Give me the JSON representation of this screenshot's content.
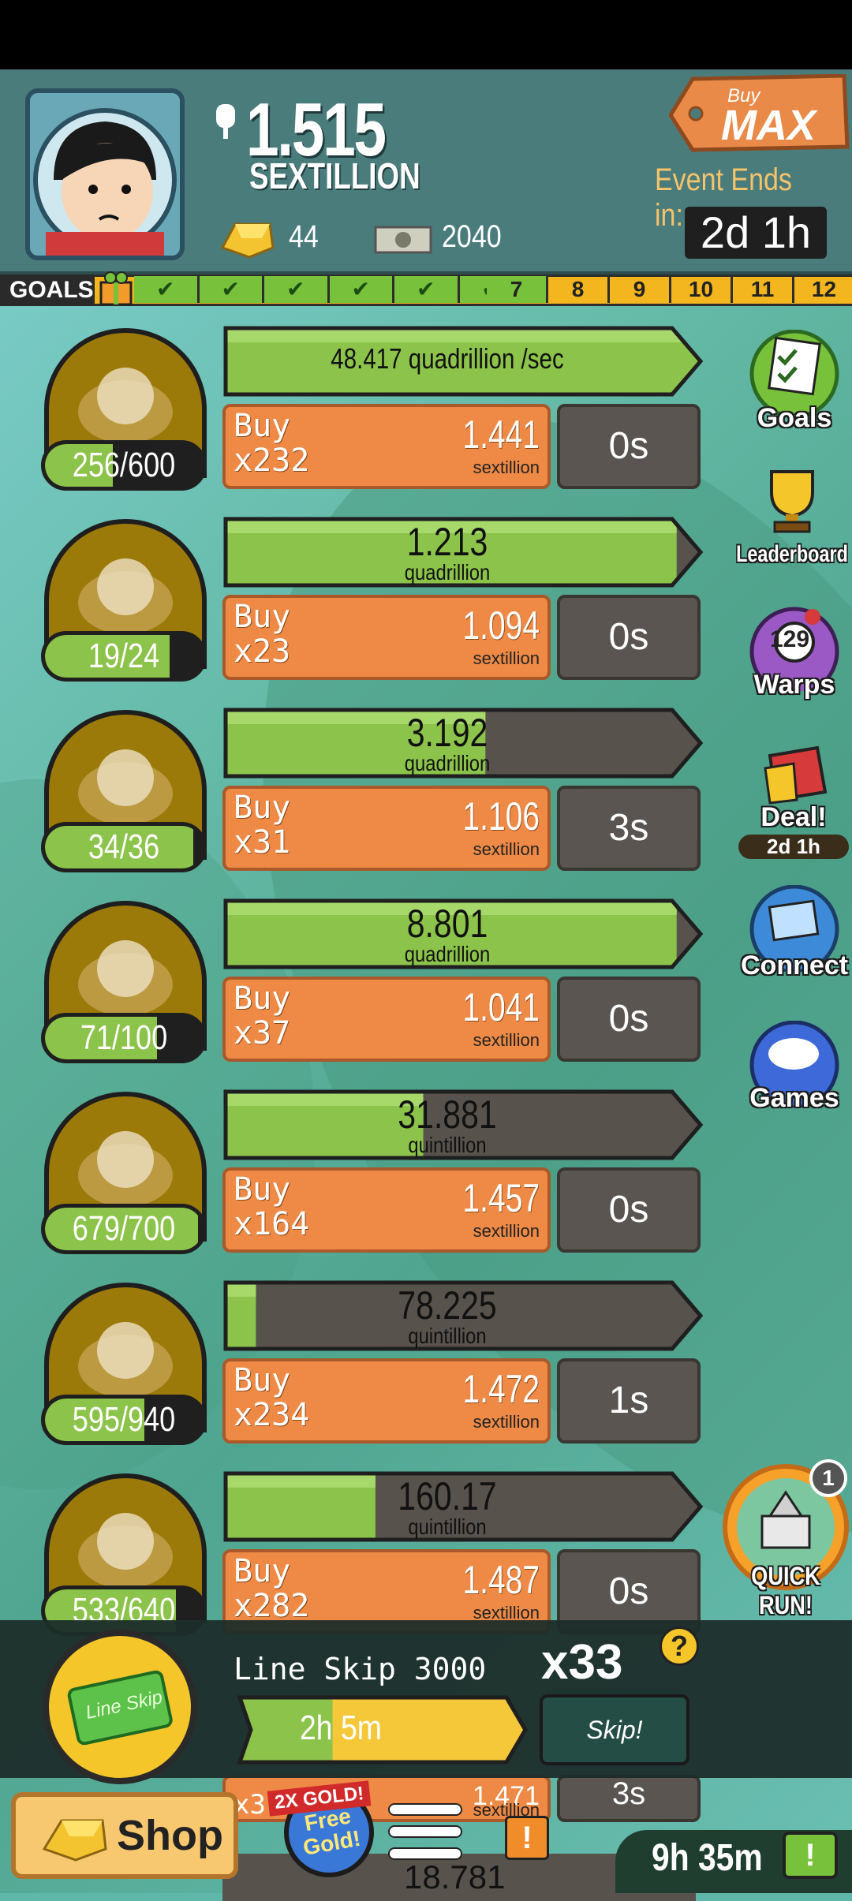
{
  "header": {
    "money_value": "1.515",
    "money_unit": "SEXTILLION",
    "gold_count": "44",
    "megabucks_count": "2040",
    "buy_max_prefix": "Buy",
    "buy_max_label": "MAX",
    "event_label": "Event Ends in:",
    "event_timer": "2d 1h"
  },
  "goals_bar": {
    "label": "GOALS",
    "completed_count": 6,
    "upcoming": [
      "7",
      "8",
      "9",
      "10",
      "11",
      "12"
    ]
  },
  "businesses": [
    {
      "icon": "lemonade-road-icon",
      "count": "256/600",
      "count_progress": 0.43,
      "production": "48.417 quadrillion /sec",
      "production_unit": "",
      "production_progress": 1.0,
      "buy_label": "Buy",
      "buy_qty": "x232",
      "cost": "1.441",
      "cost_unit": "sextillion",
      "timer": "0s"
    },
    {
      "icon": "newspaper-bowl-icon",
      "count": "19/24",
      "count_progress": 0.79,
      "production": "1.213",
      "production_unit": "quadrillion",
      "production_progress": 0.95,
      "buy_label": "Buy",
      "buy_qty": "x23",
      "cost": "1.094",
      "cost_unit": "sextillion",
      "timer": "0s"
    },
    {
      "icon": "potion-bottle-icon",
      "count": "34/36",
      "count_progress": 0.94,
      "production": "3.192",
      "production_unit": "quadrillion",
      "production_progress": 0.55,
      "buy_label": "Buy",
      "buy_qty": "x31",
      "cost": "1.106",
      "cost_unit": "sextillion",
      "timer": "3s"
    },
    {
      "icon": "drumstick-icon",
      "count": "71/100",
      "count_progress": 0.71,
      "production": "8.801",
      "production_unit": "quadrillion",
      "production_progress": 0.95,
      "buy_label": "Buy",
      "buy_qty": "x37",
      "cost": "1.041",
      "cost_unit": "sextillion",
      "timer": "0s"
    },
    {
      "icon": "animal-cage-icon",
      "count": "679/700",
      "count_progress": 0.97,
      "production": "31.881",
      "production_unit": "quintillion",
      "production_progress": 0.42,
      "buy_label": "Buy",
      "buy_qty": "x164",
      "cost": "1.457",
      "cost_unit": "sextillion",
      "timer": "0s"
    },
    {
      "icon": "jar-wand-icon",
      "count": "595/940",
      "count_progress": 0.63,
      "production": "78.225",
      "production_unit": "quintillion",
      "production_progress": 0.07,
      "buy_label": "Buy",
      "buy_qty": "x234",
      "cost": "1.472",
      "cost_unit": "sextillion",
      "timer": "1s"
    },
    {
      "icon": "tusk-building-icon",
      "count": "533/640",
      "count_progress": 0.83,
      "production": "160.17",
      "production_unit": "quintillion",
      "production_progress": 0.32,
      "buy_label": "Buy",
      "buy_qty": "x282",
      "cost": "1.487",
      "cost_unit": "sextillion",
      "timer": "0s"
    }
  ],
  "sidebar": {
    "goals_label": "Goals",
    "leaderboard_label": "Leaderboard",
    "warps_label": "Warps",
    "warps_count": "129",
    "deal_label": "Deal!",
    "deal_timer": "2d 1h",
    "connect_label": "Connect",
    "games_label": "Games",
    "quickrun_label": "QUICK RUN!",
    "quickrun_badge": "1"
  },
  "line_skip": {
    "title": "Line Skip 3000",
    "multiplier": "x33",
    "help": "?",
    "time": "2h 5m",
    "time_progress": 0.35,
    "skip_label": "Skip!",
    "coin_text": "Line Skip"
  },
  "bottom_bar": {
    "shop_label": "Shop",
    "free_gold_tag": "2X GOLD!",
    "free_gold_label": "Free Gold!",
    "alert": "!",
    "corner_time": "9h 35m",
    "corner_alert": "!"
  },
  "hidden_row": {
    "buy_qty_partial": "x3",
    "cost_partial": "1.471",
    "cost_unit": "sextillion",
    "timer_partial": "3s",
    "production_partial": "18.781"
  },
  "colors": {
    "production_green": "#8cc34a",
    "production_empty": "#57524c",
    "buy_orange": "#ee8a45",
    "gold_yellow": "#f3b61f",
    "header_teal": "#4b7c7c"
  }
}
